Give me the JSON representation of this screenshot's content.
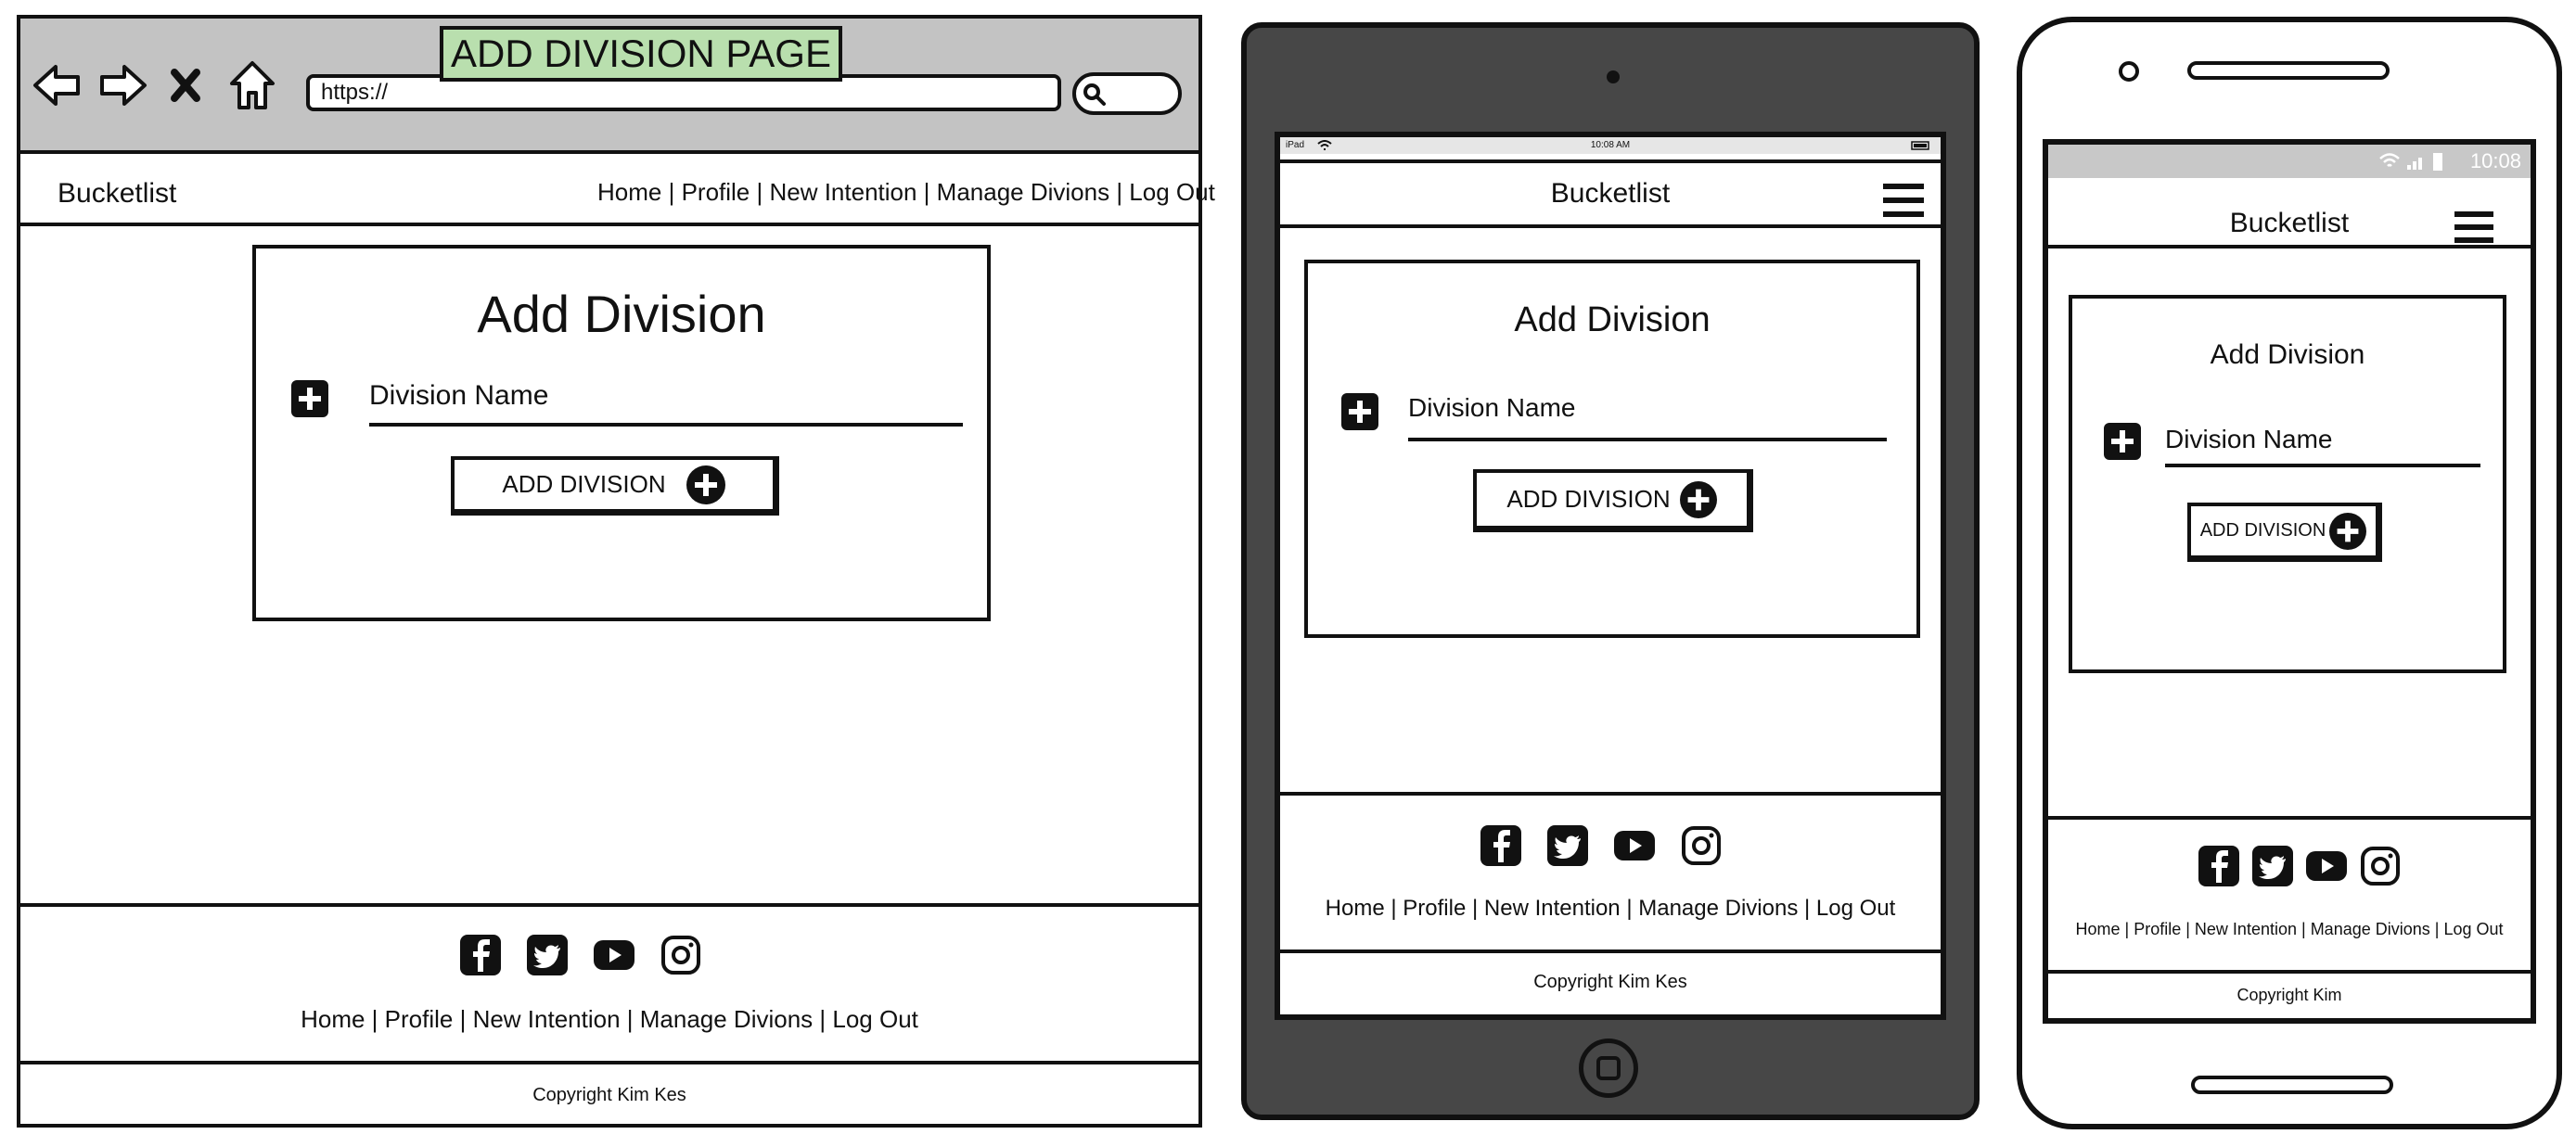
{
  "desktop": {
    "page_tag": "ADD DIVISION PAGE",
    "url": "https://",
    "brand": "Bucketlist",
    "nav": [
      "Home",
      "Profile",
      "New Intention",
      "Manage Divions",
      "Log Out"
    ],
    "card_title": "Add Division",
    "field_label": "Division Name",
    "button_label": "ADD DIVISION",
    "footer_links": [
      "Home",
      "Profile",
      "New Intention",
      "Manage Divions",
      "Log Out"
    ],
    "copyright": "Copyright Kim Kes"
  },
  "tablet": {
    "status_left": "iPad",
    "status_time": "10:08 AM",
    "brand": "Bucketlist",
    "card_title": "Add Division",
    "field_label": "Division Name",
    "button_label": "ADD DIVISION",
    "footer_links": [
      "Home",
      "Profile",
      "New Intention",
      "Manage Divions",
      "Log Out"
    ],
    "copyright": "Copyright Kim Kes"
  },
  "phone": {
    "status_time": "10:08",
    "brand": "Bucketlist",
    "card_title": "Add Division",
    "field_label": "Division Name",
    "button_label": "ADD DIVISION",
    "footer_links": [
      "Home",
      "Profile",
      "New Intention",
      "Manage Divions",
      "Log Out"
    ],
    "copyright": "Copyright Kim"
  },
  "social_icons": [
    "facebook-icon",
    "twitter-icon",
    "youtube-icon",
    "instagram-icon"
  ],
  "colors": {
    "browser_chrome": "#c3c3c3",
    "page_tag_bg": "#b9dfae",
    "tablet_body": "#474747",
    "phone_status": "#c8c8c8",
    "ink": "#111111"
  }
}
